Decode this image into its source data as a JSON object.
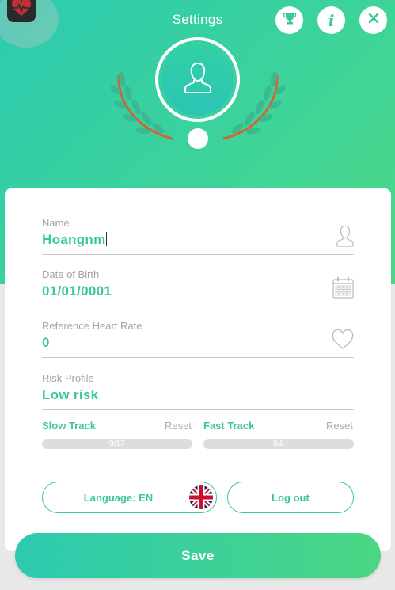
{
  "header": {
    "title": "Settings",
    "app_icon": "heart-rate-app-icon",
    "buttons": {
      "trophy": "trophy-icon",
      "info": "info-icon",
      "close": "close-icon"
    }
  },
  "profile": {
    "avatar": "user-silhouette-icon",
    "decoration": "laurel-wreath"
  },
  "form": {
    "name": {
      "label": "Name",
      "value": "Hoangnm",
      "icon": "user-outline-icon"
    },
    "dob": {
      "label": "Date of Birth",
      "value": "01/01/0001",
      "icon": "calendar-icon"
    },
    "heart_rate": {
      "label": "Reference Heart Rate",
      "value": "0",
      "icon": "heart-outline-icon"
    },
    "risk": {
      "label": "Risk Profile",
      "value": "Low risk"
    }
  },
  "tracks": {
    "slow": {
      "label": "Slow Track",
      "reset": "Reset",
      "progress": "0/17",
      "fraction": 0
    },
    "fast": {
      "label": "Fast Track",
      "reset": "Reset",
      "progress": "0/8",
      "fraction": 0
    }
  },
  "actions": {
    "language": "Language: EN",
    "language_flag": "uk-flag-icon",
    "logout": "Log out",
    "save": "Save"
  },
  "colors": {
    "accent": "#3cc98f",
    "gradient_start": "#2dcab0",
    "gradient_end": "#4cd783",
    "laurel_leaf": "#3bb68e",
    "laurel_stem": "#d2643a"
  }
}
